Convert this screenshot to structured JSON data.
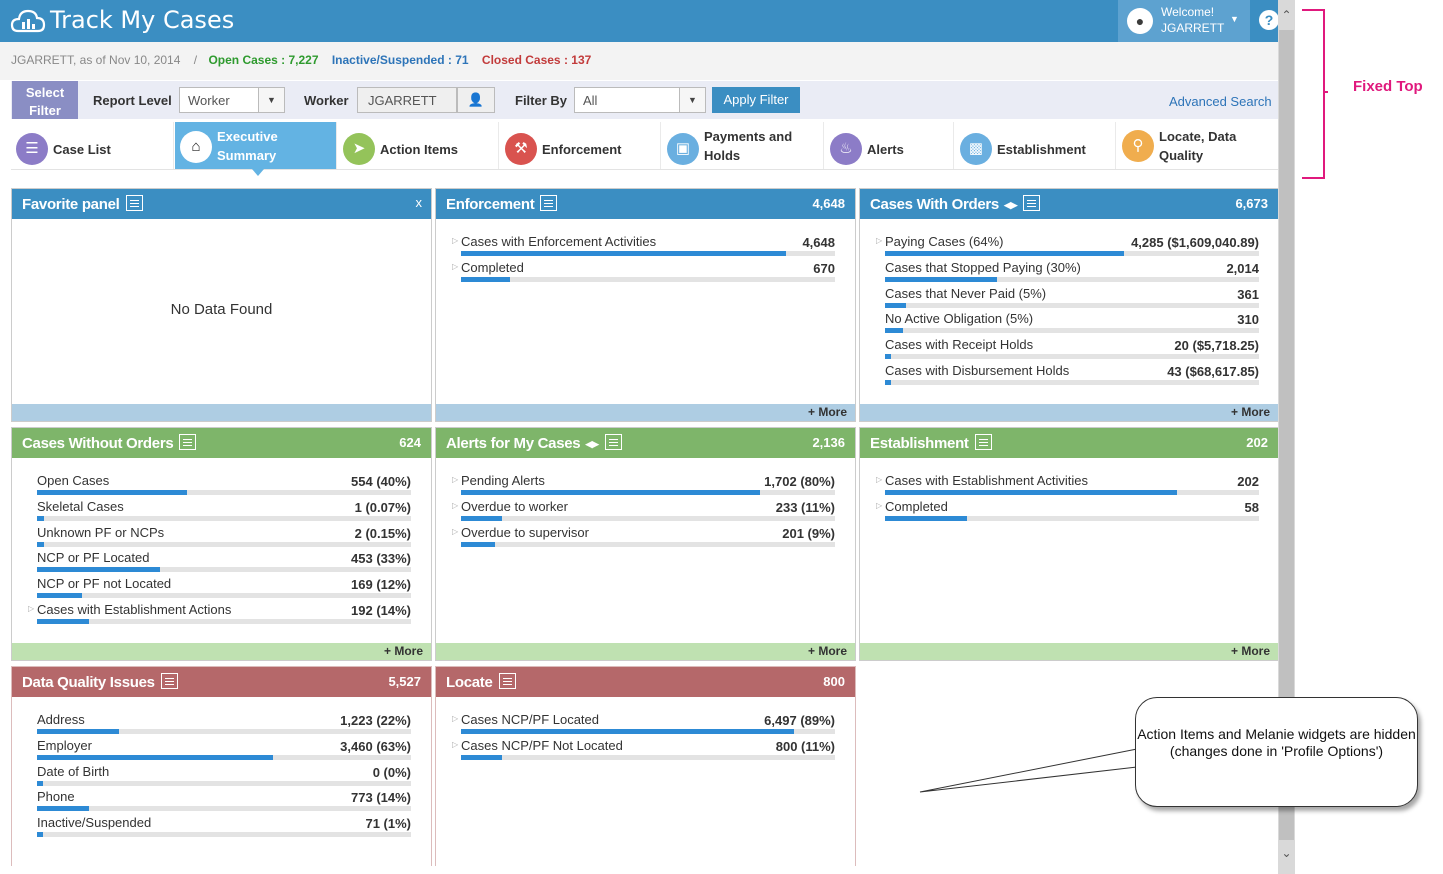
{
  "header": {
    "title": "Track My Cases",
    "welcome": "Welcome!",
    "username": "JGARRETT",
    "help_label": "?"
  },
  "info": {
    "as_of": "JGARRETT, as of Nov 10, 2014",
    "separator": "/",
    "open_cases": "Open Cases : 7,227",
    "inactive": "Inactive/Suspended : 71",
    "closed": "Closed Cases : 137"
  },
  "filter": {
    "select_filter": "Select Filter",
    "report_level_label": "Report Level",
    "report_level_value": "Worker",
    "worker_label": "Worker",
    "worker_value": "JGARRETT",
    "filter_by_label": "Filter By",
    "filter_by_value": "All",
    "apply_label": "Apply Filter",
    "advanced_search": "Advanced Search"
  },
  "tabs": [
    {
      "label": "Case List",
      "icon": "list-icon",
      "color": "#8c7cc7"
    },
    {
      "label": "Executive Summary",
      "icon": "home-icon",
      "color": "#ffffff",
      "active": true
    },
    {
      "label": "Action Items",
      "icon": "paper-plane-icon",
      "color": "#94c35a"
    },
    {
      "label": "Enforcement",
      "icon": "gavel-icon",
      "color": "#d9534f"
    },
    {
      "label": "Payments and Holds",
      "icon": "money-icon",
      "color": "#6aafe0"
    },
    {
      "label": "Alerts",
      "icon": "bell-icon",
      "color": "#8c7cc7"
    },
    {
      "label": "Establishment",
      "icon": "briefcase-icon",
      "color": "#6aafe0"
    },
    {
      "label": "Locate, Data Quality",
      "icon": "map-marker-icon",
      "color": "#f0ad4e"
    }
  ],
  "panels": {
    "favorite": {
      "title": "Favorite panel",
      "close": "x",
      "empty": "No Data Found"
    },
    "enforcement": {
      "title": "Enforcement",
      "count": "4,648",
      "more": "+ More",
      "rows": [
        {
          "label": "Cases with Enforcement Activities",
          "value": "4,648",
          "pct": 0.87,
          "expand": true
        },
        {
          "label": "Completed",
          "value": "670",
          "pct": 0.13,
          "expand": true
        }
      ]
    },
    "orders": {
      "title": "Cases With Orders",
      "count": "6,673",
      "more": "+ More",
      "rows": [
        {
          "label": "Paying Cases (64%)",
          "value": "4,285 ($1,609,040.89)",
          "pct": 0.64,
          "expand": true
        },
        {
          "label": "Cases that Stopped Paying (30%)",
          "value": "2,014",
          "pct": 0.3
        },
        {
          "label": "Cases that Never Paid (5%)",
          "value": "361",
          "pct": 0.055
        },
        {
          "label": "No Active Obligation (5%)",
          "value": "310",
          "pct": 0.047
        },
        {
          "label": "Cases with Receipt Holds",
          "value": "20 ($5,718.25)",
          "pct": 0.01
        },
        {
          "label": "Cases with Disbursement Holds",
          "value": "43 ($68,617.85)",
          "pct": 0.01
        }
      ]
    },
    "without_orders": {
      "title": "Cases Without Orders",
      "count": "624",
      "more": "+ More",
      "rows": [
        {
          "label": "Open Cases",
          "value": "554 (40%)",
          "pct": 0.4
        },
        {
          "label": "Skeletal Cases",
          "value": "1 (0.07%)",
          "pct": 0.02
        },
        {
          "label": "Unknown PF or NCPs",
          "value": "2 (0.15%)",
          "pct": 0.02
        },
        {
          "label": "NCP or PF Located",
          "value": "453 (33%)",
          "pct": 0.33
        },
        {
          "label": "NCP or PF not Located",
          "value": "169 (12%)",
          "pct": 0.12
        },
        {
          "label": "Cases with Establishment Actions",
          "value": "192 (14%)",
          "pct": 0.14,
          "expand": true
        }
      ]
    },
    "alerts": {
      "title": "Alerts for My Cases",
      "count": "2,136",
      "more": "+ More",
      "rows": [
        {
          "label": "Pending Alerts",
          "value": "1,702 (80%)",
          "pct": 0.8,
          "expand": true
        },
        {
          "label": "Overdue to worker",
          "value": "233 (11%)",
          "pct": 0.11,
          "expand": true
        },
        {
          "label": "Overdue to supervisor",
          "value": "201 (9%)",
          "pct": 0.09,
          "expand": true
        }
      ]
    },
    "establishment": {
      "title": "Establishment",
      "count": "202",
      "more": "+ More",
      "rows": [
        {
          "label": "Cases with Establishment Activities",
          "value": "202",
          "pct": 0.78,
          "expand": true
        },
        {
          "label": "Completed",
          "value": "58",
          "pct": 0.22,
          "expand": true
        }
      ]
    },
    "data_quality": {
      "title": "Data Quality Issues",
      "count": "5,527",
      "rows": [
        {
          "label": "Address",
          "value": "1,223 (22%)",
          "pct": 0.22
        },
        {
          "label": "Employer",
          "value": "3,460 (63%)",
          "pct": 0.63
        },
        {
          "label": "Date of Birth",
          "value": "0 (0%)",
          "pct": 0.0
        },
        {
          "label": "Phone",
          "value": "773 (14%)",
          "pct": 0.14
        },
        {
          "label": "Inactive/Suspended",
          "value": "71 (1%)",
          "pct": 0.015
        }
      ]
    },
    "locate": {
      "title": "Locate",
      "count": "800",
      "rows": [
        {
          "label": "Cases NCP/PF Located",
          "value": "6,497 (89%)",
          "pct": 0.89,
          "expand": true
        },
        {
          "label": "Cases NCP/PF Not Located",
          "value": "800 (11%)",
          "pct": 0.11,
          "expand": true
        }
      ]
    }
  },
  "annotations": {
    "fixed_top": "Fixed Top",
    "callout": "Action Items and Melanie widgets are hidden (changes done in 'Profile Options')"
  },
  "colors": {
    "header": "#3b8ec2",
    "fixed_top": "#e0197d"
  }
}
